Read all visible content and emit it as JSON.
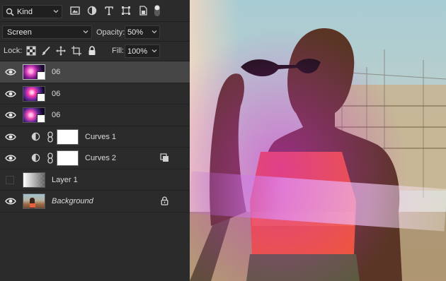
{
  "filter": {
    "kind_label": "Kind"
  },
  "blend": {
    "mode": "Screen",
    "opacity_label": "Opacity:",
    "opacity_value": "50%"
  },
  "lock": {
    "label": "Lock:",
    "fill_label": "Fill:",
    "fill_value": "100%"
  },
  "layers": [
    {
      "name": "06",
      "type": "smart-object",
      "visible": true,
      "selected": true
    },
    {
      "name": "06",
      "type": "smart-object",
      "visible": true,
      "selected": false
    },
    {
      "name": "06",
      "type": "smart-object",
      "visible": true,
      "selected": false
    },
    {
      "name": "Curves 1",
      "type": "curves-adjustment",
      "visible": true,
      "selected": false
    },
    {
      "name": "Curves 2",
      "type": "curves-adjustment",
      "visible": true,
      "selected": false,
      "badge": "clipping-icon"
    },
    {
      "name": "Layer 1",
      "type": "pixel",
      "visible": false,
      "selected": false
    },
    {
      "name": "Background",
      "type": "background",
      "visible": true,
      "selected": false,
      "badge": "lock-icon"
    }
  ],
  "colors": {
    "panel_bg": "#2b2b2b",
    "selected_row": "#464646",
    "field_bg": "#1f1f1f"
  }
}
